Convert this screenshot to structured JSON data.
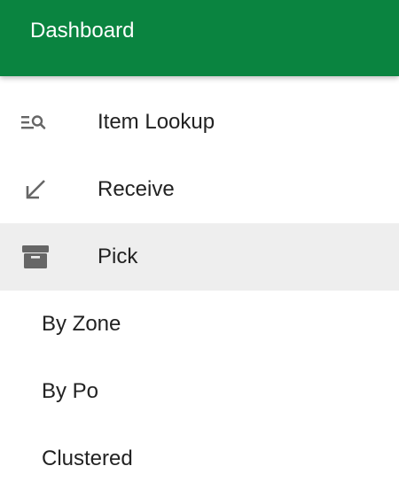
{
  "header": {
    "title": "Dashboard",
    "color": "#0a8440"
  },
  "menu": {
    "items": [
      {
        "label": "Item Lookup",
        "icon": "list-search-icon"
      },
      {
        "label": "Receive",
        "icon": "arrow-down-left-icon"
      },
      {
        "label": "Pick",
        "icon": "archive-box-icon",
        "active": true
      }
    ],
    "sub_items": [
      {
        "label": "By Zone"
      },
      {
        "label": "By Po"
      },
      {
        "label": "Clustered"
      }
    ]
  },
  "colors": {
    "icon": "#666666",
    "active_bg": "#eeeeee",
    "text": "#222222"
  }
}
